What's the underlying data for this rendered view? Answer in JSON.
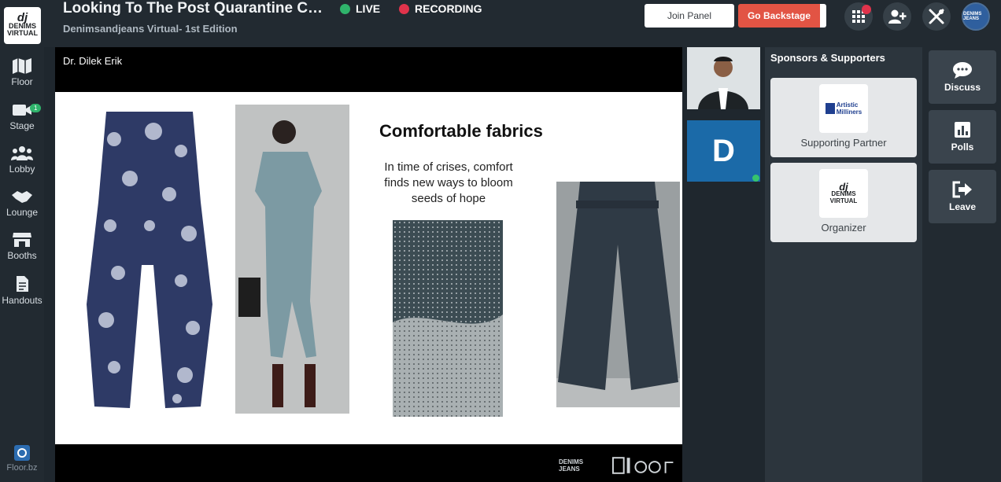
{
  "header": {
    "title": "Looking To The Post Quarantine Cons...",
    "subtitle": "Denimsandjeans Virtual- 1st Edition",
    "live_label": "LIVE",
    "recording_label": "RECORDING",
    "join_panel_label": "Join Panel",
    "go_backstage_label": "Go Backstage",
    "logo_text_top": "DENIMS",
    "logo_text_mid": "JEANS",
    "logo_text_bottom": "VIRTUAL",
    "avatar_text": "DENIMS JEANS",
    "colors": {
      "live": "#2fb36b",
      "recording": "#e0334b",
      "backstage": "#e25444"
    }
  },
  "nav": {
    "items": [
      {
        "label": "Floor",
        "icon": "map-icon"
      },
      {
        "label": "Stage",
        "icon": "camera-icon",
        "badge": "1"
      },
      {
        "label": "Lobby",
        "icon": "people-icon"
      },
      {
        "label": "Lounge",
        "icon": "handshake-icon"
      },
      {
        "label": "Booths",
        "icon": "store-icon"
      },
      {
        "label": "Handouts",
        "icon": "document-icon"
      }
    ],
    "brand_label": "Floor.bz"
  },
  "stage": {
    "speaker_name": "Dr. Dilek Erik",
    "slide_title": "Comfortable fabrics",
    "slide_lines": [
      "In time of crises, comfort",
      "finds new ways to bloom",
      "seeds of hope"
    ],
    "footer_logo": "DENIMS JEANS"
  },
  "videos": {
    "initial": "D"
  },
  "sponsors": {
    "title": "Sponsors & Supporters",
    "cards": [
      {
        "label": "Supporting Partner",
        "logo_line1": "Artistic",
        "logo_line2": "Milliners"
      },
      {
        "label": "Organizer",
        "logo_line1": "DENIMS",
        "logo_line2": "VIRTUAL"
      }
    ]
  },
  "actions": [
    {
      "label": "Discuss",
      "icon": "chat-icon"
    },
    {
      "label": "Polls",
      "icon": "poll-icon"
    },
    {
      "label": "Leave",
      "icon": "exit-icon"
    }
  ]
}
